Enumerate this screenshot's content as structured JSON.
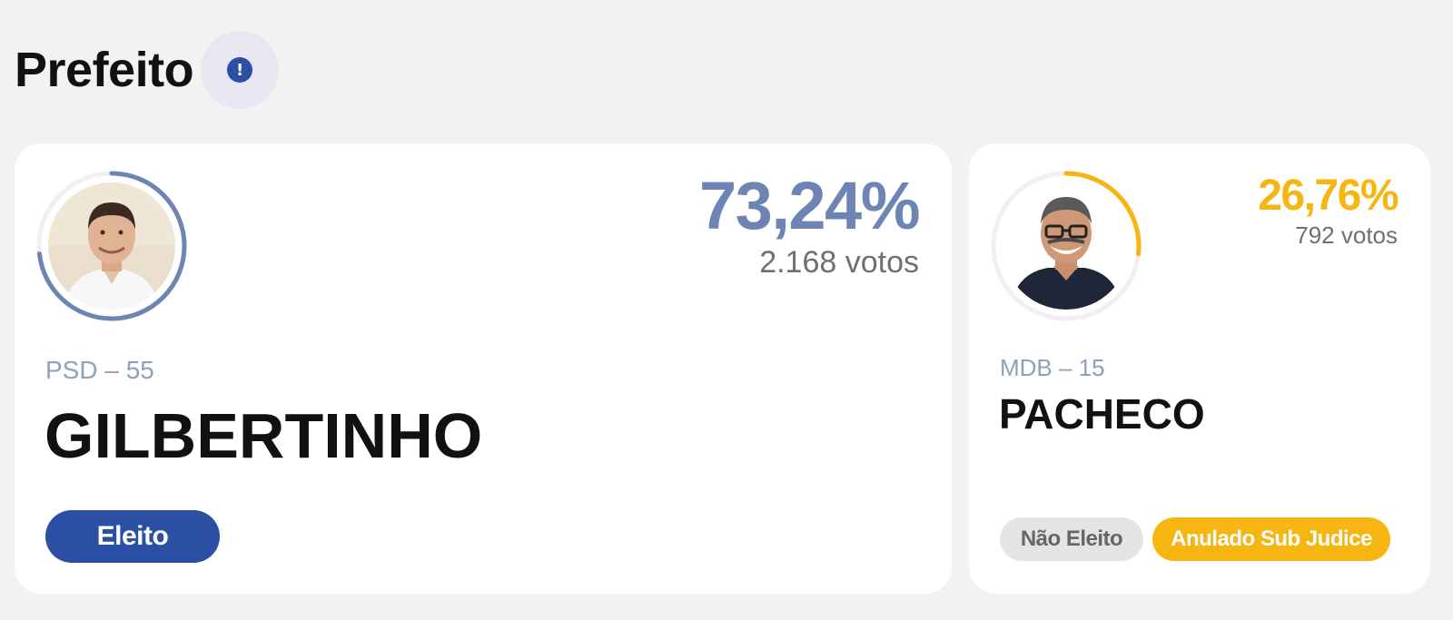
{
  "header": {
    "title": "Prefeito",
    "info_icon": "exclamation-icon"
  },
  "candidates": [
    {
      "percent": "73,24%",
      "votes": "2.168 votos",
      "party": "PSD – 55",
      "name": "GILBERTINHO",
      "status": [
        "Eleito"
      ],
      "vote_share": 0.7324,
      "color": "#6d84b4"
    },
    {
      "percent": "26,76%",
      "votes": "792 votos",
      "party": "MDB – 15",
      "name": "PACHECO",
      "status": [
        "Não Eleito",
        "Anulado Sub Judice"
      ],
      "vote_share": 0.2676,
      "color": "#f7b512"
    }
  ],
  "colors": {
    "background": "#f2f2f2",
    "card": "#ffffff",
    "elected_badge": "#2b4fa2",
    "not_elected_badge": "#e4e4e4",
    "sub_judice_badge": "#f7b512",
    "party_text": "#8ea1bb"
  }
}
